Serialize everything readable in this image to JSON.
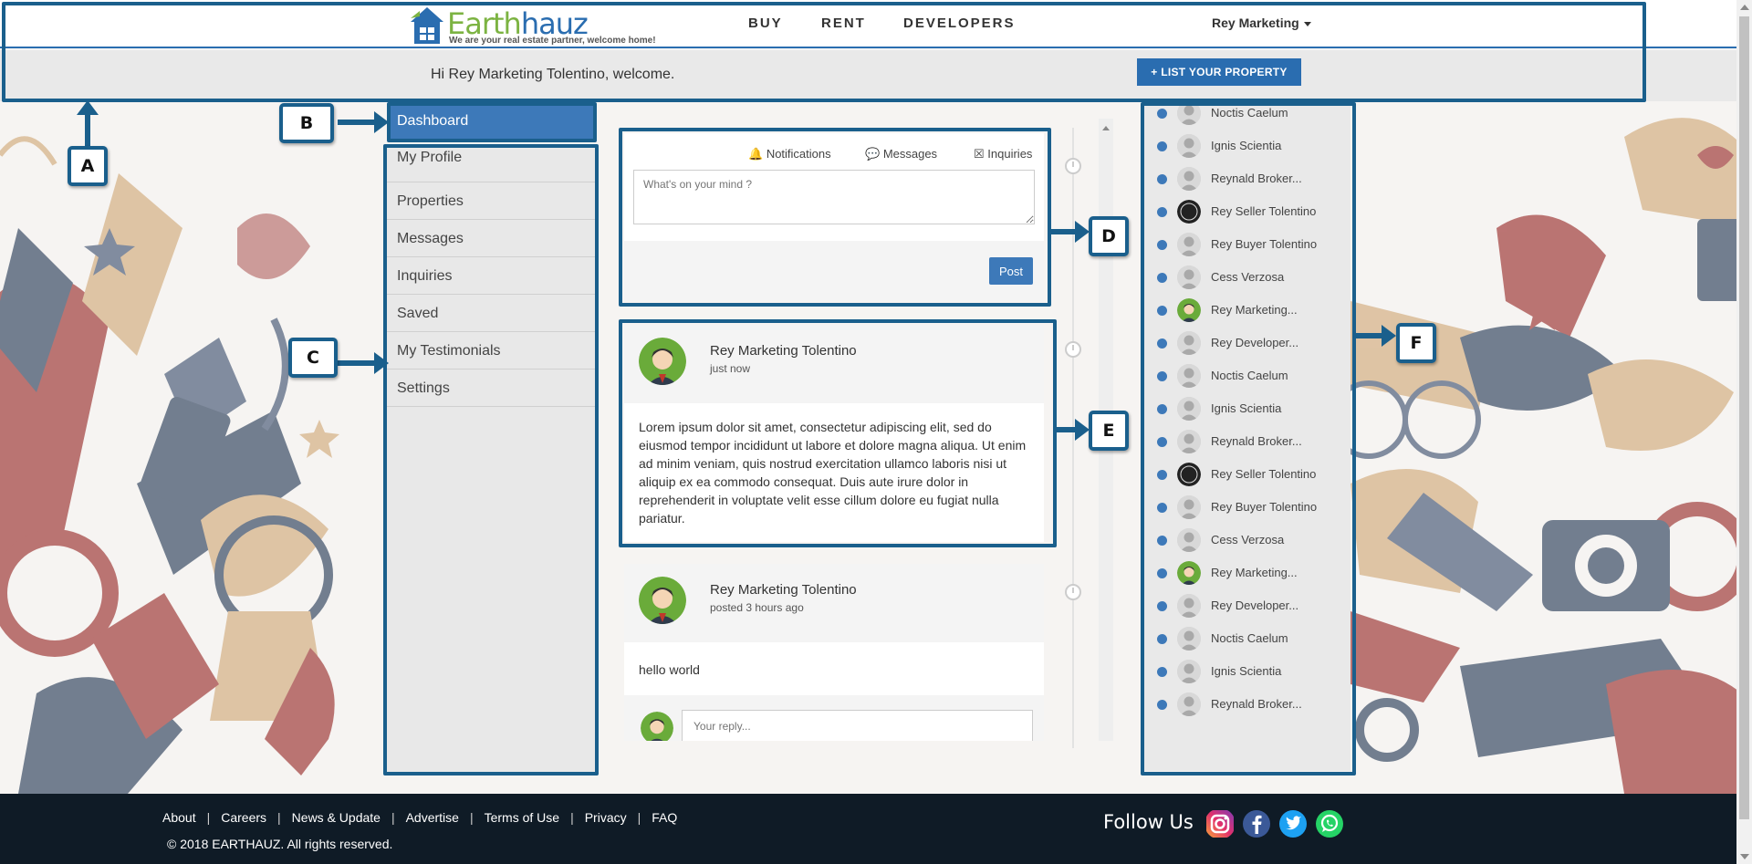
{
  "brand": {
    "name_part1": "Earth",
    "name_part2": "hauz",
    "tagline": "We are your real estate partner, welcome home!"
  },
  "nav": {
    "buy": "BUY",
    "rent": "RENT",
    "developers": "DEVELOPERS",
    "user_menu": "Rey Marketing"
  },
  "welcome": {
    "message": "Hi Rey Marketing Tolentino, welcome.",
    "list_button": "LIST YOUR PROPERTY"
  },
  "annotations": {
    "a": "A",
    "b": "B",
    "c": "C",
    "d": "D",
    "e": "E",
    "f": "F"
  },
  "sidebar": {
    "active": "Dashboard",
    "items": [
      "My Profile",
      "Properties",
      "Messages",
      "Inquiries",
      "Saved",
      "My Testimonials",
      "Settings"
    ]
  },
  "composer": {
    "tab_notifications": "Notifications",
    "tab_messages": "Messages",
    "tab_inquiries": "Inquiries",
    "placeholder": "What's on your mind ?",
    "post_button": "Post"
  },
  "posts": [
    {
      "author": "Rey Marketing Tolentino",
      "time": "just now",
      "body": "Lorem ipsum dolor sit amet, consectetur adipiscing elit, sed do eiusmod tempor incididunt ut labore et dolore magna aliqua. Ut enim ad minim veniam, quis nostrud exercitation ullamco laboris nisi ut aliquip ex ea commodo consequat. Duis aute irure dolor in reprehenderit in voluptate velit esse cillum dolore eu fugiat nulla pariatur."
    },
    {
      "author": "Rey Marketing Tolentino",
      "time": "posted 3 hours ago",
      "body": "hello world",
      "reply_placeholder": "Your reply..."
    }
  ],
  "contacts": [
    "Noctis Caelum",
    "Ignis Scientia",
    "Reynald Broker...",
    "Rey Seller Tolentino",
    "Rey Buyer Tolentino",
    "Cess Verzosa",
    "Rey Marketing...",
    "Rey Developer...",
    "Noctis Caelum",
    "Ignis Scientia",
    "Reynald Broker...",
    "Rey Seller Tolentino",
    "Rey Buyer Tolentino",
    "Cess Verzosa",
    "Rey Marketing...",
    "Rey Developer...",
    "Noctis Caelum",
    "Ignis Scientia",
    "Reynald Broker..."
  ],
  "footer": {
    "links": [
      "About",
      "Careers",
      "News & Update",
      "Advertise",
      "Terms of Use",
      "Privacy",
      "FAQ"
    ],
    "copyright": "© 2018 EARTHAUZ. All rights reserved.",
    "follow_us": "Follow Us"
  },
  "colors": {
    "primary": "#3d79b9",
    "annotation": "#1a5f8c",
    "footer_bg": "#0f1b26",
    "brand_green": "#7cb342"
  }
}
